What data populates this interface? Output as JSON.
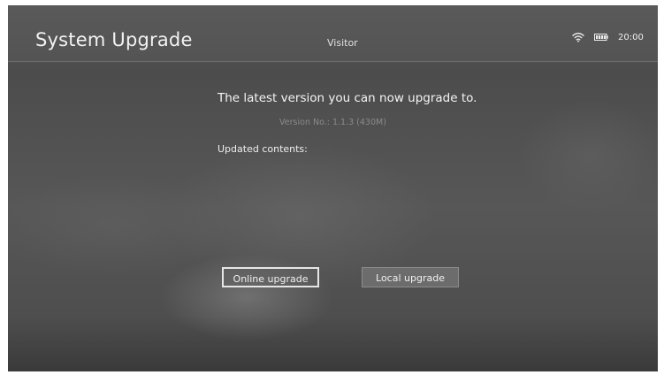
{
  "header": {
    "title": "System Upgrade",
    "user": "Visitor",
    "time": "20:00",
    "icons": [
      "wifi-icon",
      "battery-icon"
    ]
  },
  "main": {
    "headline": "The latest version you can now upgrade to.",
    "version": "Version No.: 1.1.3 (430M)",
    "contents_label": "Updated contents:"
  },
  "buttons": {
    "online": "Online upgrade",
    "local": "Local upgrade"
  }
}
